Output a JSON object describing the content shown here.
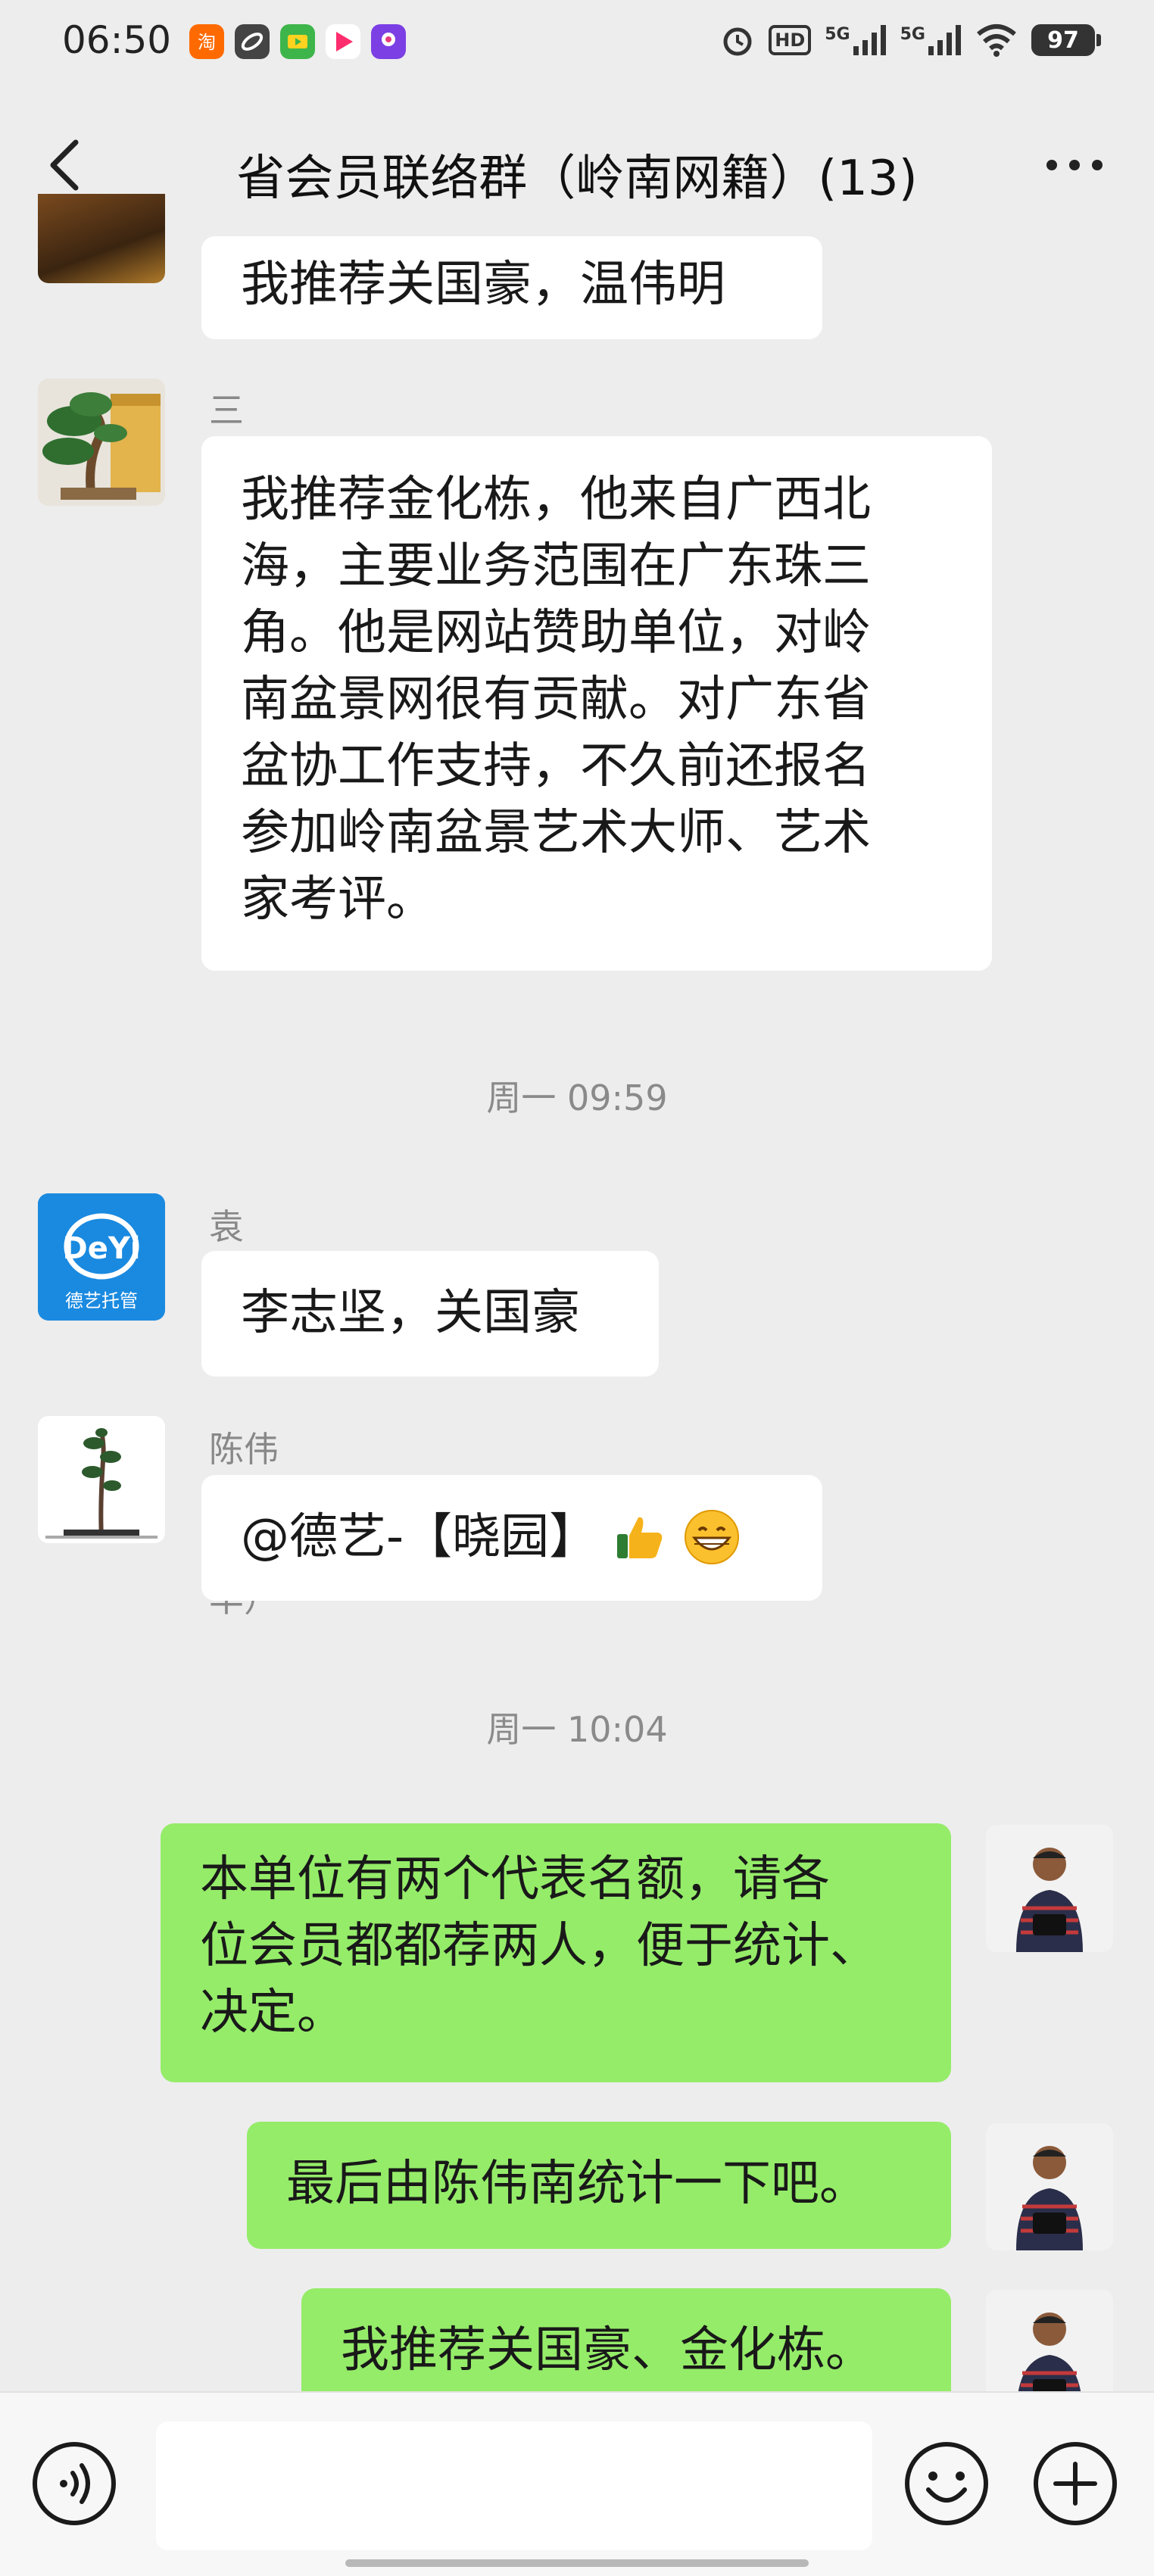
{
  "status_bar": {
    "time": "06:50",
    "network_1": "5G",
    "network_2": "5G",
    "hd_label": "HD",
    "battery": "97"
  },
  "header": {
    "title": "省会员联络群（岭南网籍）(13)"
  },
  "messages": [
    {
      "type": "in",
      "sender": "",
      "lines": [
        "我推荐关国豪，温伟明"
      ]
    },
    {
      "type": "in",
      "sender": "三水艺能松苑关国豪",
      "lines": [
        "我推荐金化栋，他来自广西北",
        "海，主要业务范围在广东珠三",
        "角。他是网站赞助单位，对岭",
        "南盆景网很有贡献。对广东省",
        "盆协工作支持，不久前还报名",
        "参加岭南盆景艺术大师、艺术",
        "家考评。"
      ]
    },
    {
      "type": "time",
      "text": "周一 09:59"
    },
    {
      "type": "in",
      "sender": "袁敏华",
      "lines": [
        "李志坚，关国豪"
      ],
      "avatar_text": "德艺托管",
      "avatar_logo": "DeYi"
    },
    {
      "type": "in",
      "sender": "陈伟南(陆丰）",
      "lines": [
        "@德艺-【晓园】"
      ]
    },
    {
      "type": "time",
      "text": "周一 10:04"
    },
    {
      "type": "out",
      "lines": [
        "本单位有两个代表名额，请各",
        "位会员都都荐两人，便于统计、",
        "决定。"
      ]
    },
    {
      "type": "out",
      "lines": [
        "最后由陈伟南统计一下吧。"
      ]
    },
    {
      "type": "out",
      "lines": [
        "我推荐关国豪、金化栋。"
      ]
    }
  ],
  "icons": {
    "back": "chevron-left-icon",
    "more": "more-dots-icon",
    "voice": "voice-icon",
    "emoji": "emoji-icon",
    "plus": "plus-icon"
  },
  "colors": {
    "background": "#ededed",
    "outgoing_bubble": "#95ec69",
    "incoming_bubble": "#ffffff",
    "meta_text": "#888888"
  }
}
